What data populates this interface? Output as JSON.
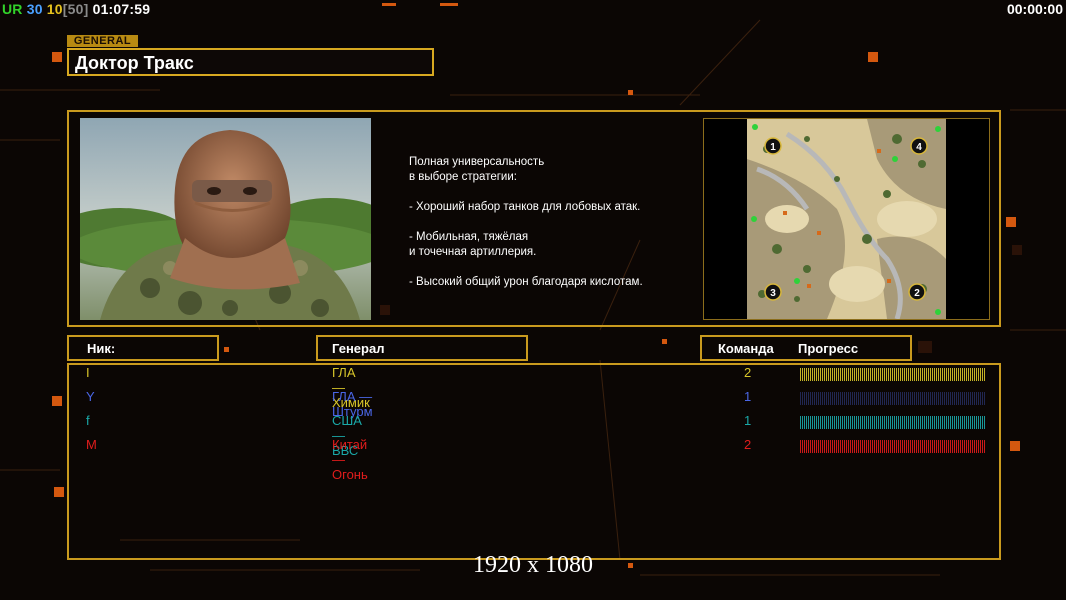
{
  "hud": {
    "ur_label": "UR",
    "ur_value": "30",
    "count_a": "10",
    "count_b": "[50]",
    "clock": "01:07:59",
    "timer": "00:00:00"
  },
  "general": {
    "tag": "GENERAL",
    "name": "Доктор Тракс"
  },
  "description": [
    "Полная универсальность",
    "в выборе стратегии:",
    "",
    "- Хороший набор танков для лобовых атак.",
    "",
    "- Мобильная, тяжёлая",
    "и точечная артиллерия.",
    "",
    "- Высокий общий урон благодаря кислотам."
  ],
  "map": {
    "spawns": [
      "1",
      "4",
      "3",
      "2"
    ]
  },
  "columns": {
    "nick": "Ник:",
    "general": "Генерал",
    "team": "Команда",
    "progress": "Прогресс"
  },
  "players": [
    {
      "nick": "I",
      "general": "ГЛА — Химик",
      "team": "2",
      "color": "#d8c62a",
      "progress": 1.0
    },
    {
      "nick": "Y",
      "general": "ГЛА — Штурм",
      "team": "1",
      "color": "#4a66e6",
      "progress": 1.0
    },
    {
      "nick": "f",
      "general": "США — ВВС",
      "team": "1",
      "color": "#1aa8a8",
      "progress": 1.0
    },
    {
      "nick": "M",
      "general": "Китай — Огонь",
      "team": "2",
      "color": "#e01c1c",
      "progress": 1.0
    }
  ],
  "colors": {
    "accent": "#c99a1e",
    "ur": "#32d22a",
    "count_a": "#e6c21e",
    "bracket": "#8a8a8a",
    "resolution": "#ffffff"
  },
  "resolution": "1920 x 1080"
}
